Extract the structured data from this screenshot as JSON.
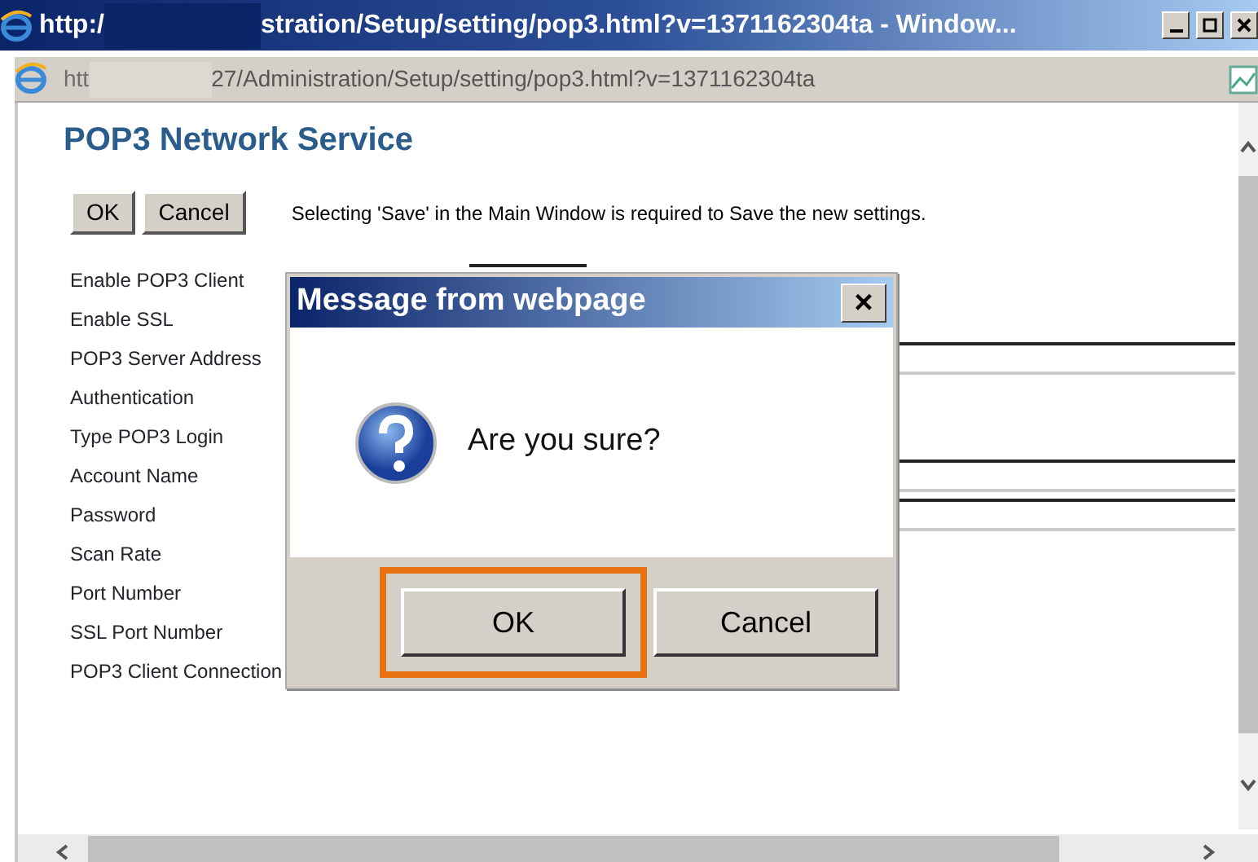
{
  "window": {
    "title_start": "http:/",
    "title_end": "stration/Setup/setting/pop3.html?v=1371162304ta - Window..."
  },
  "address_bar": {
    "url_start": "htt",
    "url_end": "27/Administration/Setup/setting/pop3.html?v=1371162304ta"
  },
  "page": {
    "heading": "POP3 Network Service",
    "buttons": [
      "OK",
      "Cancel"
    ],
    "notice": "Selecting 'Save' in the Main Window is required to Save the new settings.",
    "rows": [
      {
        "label": "Enable POP3 Client",
        "kind": "select"
      },
      {
        "label": "Enable SSL",
        "kind": "none"
      },
      {
        "label": "POP3 Server Address",
        "kind": "input"
      },
      {
        "label": "Authentication",
        "kind": "none"
      },
      {
        "label": "Type POP3 Login",
        "kind": "none"
      },
      {
        "label": "Account Name",
        "kind": "input"
      },
      {
        "label": "Password",
        "kind": "input"
      },
      {
        "label": "Scan Rate",
        "kind": "none"
      },
      {
        "label": "Port Number",
        "kind": "none"
      },
      {
        "label": "SSL Port Number",
        "kind": "none"
      },
      {
        "label": "POP3 Client Connection",
        "kind": "none"
      }
    ]
  },
  "dialog": {
    "title": "Message from webpage",
    "close": "×",
    "message": "Are you sure?",
    "buttons": [
      {
        "label": "OK",
        "highlighted": true
      },
      {
        "label": "Cancel",
        "highlighted": false
      }
    ]
  }
}
